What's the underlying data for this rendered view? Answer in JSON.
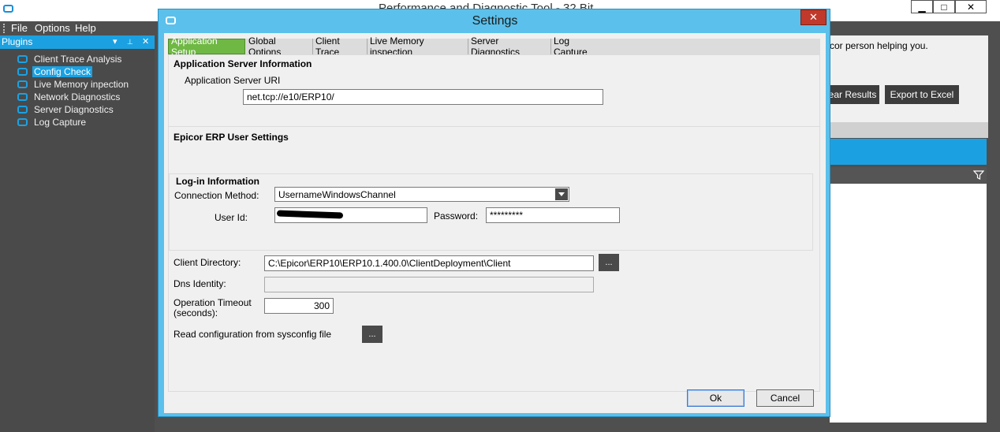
{
  "main_window": {
    "title": "Performance and Diagnostic Tool - 32 Bit",
    "controls": {
      "minimize": "▁",
      "maximize": "□",
      "close": "✕"
    }
  },
  "menu": {
    "items": [
      "File",
      "Options",
      "Help"
    ]
  },
  "plugins_panel": {
    "title": "Plugins",
    "header_buttons": {
      "dropdown": "▾",
      "pin": "📌",
      "close": "✕"
    },
    "items": [
      {
        "label": "Client Trace Analysis",
        "selected": false
      },
      {
        "label": "Config Check",
        "selected": true
      },
      {
        "label": "Live Memory inpection",
        "selected": false
      },
      {
        "label": "Network Diagnostics",
        "selected": false
      },
      {
        "label": "Server Diagnostics",
        "selected": false
      },
      {
        "label": "Log Capture",
        "selected": false
      }
    ]
  },
  "background_content": {
    "help_text_fragment": "cor person helping you.",
    "buttons": {
      "clear_results": "ear Results",
      "export_to_excel": "Export to Excel"
    }
  },
  "dialog": {
    "title": "Settings",
    "close_label": "✕",
    "tabs": [
      {
        "label": "Application Setup",
        "active": true
      },
      {
        "label": "Global Options",
        "active": false
      },
      {
        "label": "Client Trace",
        "active": false
      },
      {
        "label": "Live Memory inspection",
        "active": false
      },
      {
        "label": "Server Diagnostics",
        "active": false
      },
      {
        "label": "Log Capture",
        "active": false
      }
    ],
    "app_server": {
      "group_title": "Application Server Information",
      "uri_label": "Application Server URI",
      "uri_value": "net.tcp://e10/ERP10/"
    },
    "user_settings": {
      "group_title": "Epicor ERP User Settings",
      "login_title": "Log-in Information",
      "connection_method_label": "Connection Method:",
      "connection_method_value": "UsernameWindowsChannel",
      "user_id_label": "User Id:",
      "user_id_value": "",
      "password_label": "Password:",
      "password_value": "*********"
    },
    "client_directory": {
      "label": "Client Directory:",
      "value": "C:\\Epicor\\ERP10\\ERP10.1.400.0\\ClientDeployment\\Client",
      "browse_label": "..."
    },
    "dns_identity": {
      "label": "Dns Identity:",
      "value": ""
    },
    "operation_timeout": {
      "label_line1": "Operation Timeout",
      "label_line2": "(seconds):",
      "value": "300"
    },
    "sysconfig": {
      "label": "Read configuration from sysconfig file",
      "browse_label": "..."
    },
    "buttons": {
      "ok": "Ok",
      "cancel": "Cancel"
    }
  }
}
